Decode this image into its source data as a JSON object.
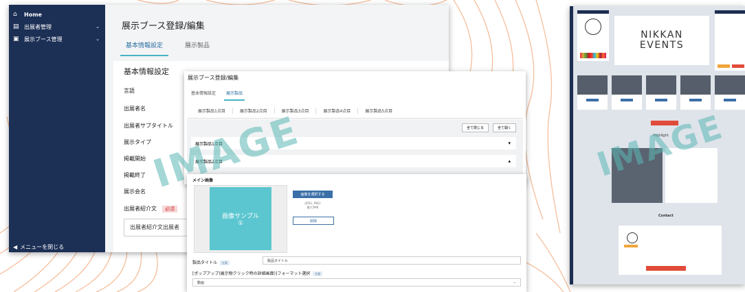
{
  "sidebar": {
    "items": [
      {
        "label": "Home",
        "icon": "home-icon"
      },
      {
        "label": "出展者管理",
        "icon": "building-icon"
      },
      {
        "label": "展示ブース管理",
        "icon": "image-icon"
      }
    ],
    "close_menu": "メニューを閉じる"
  },
  "editor": {
    "title": "展示ブース登録/編集",
    "tabs": [
      "基本情報設定",
      "展示製品"
    ],
    "section_title": "基本情報設定",
    "fields": [
      "言語",
      "出展者名",
      "出展者サブタイトル",
      "展示タイプ",
      "掲載開始",
      "掲載終了",
      "展示会名",
      "出展者紹介文"
    ],
    "required_badge": "必須",
    "intro_placeholder": "出展者紹介文出展者"
  },
  "products": {
    "title": "展示ブース登録/編集",
    "tabs": [
      "基本情報設定",
      "展示製品"
    ],
    "subtabs": [
      "展示製品1点目",
      "展示製品2点目",
      "展示製品3点目",
      "展示製品4点目",
      "展示製品5点目"
    ],
    "collapse_all": "全て閉じる",
    "expand_all": "全て開く",
    "accordions": [
      "展示製品1点目",
      "展示製品2点目"
    ]
  },
  "product_form": {
    "main_image_label": "メイン画像",
    "image_sample": "画像サンプル",
    "image_sample_num": "①",
    "select_image": "画像を選択する",
    "image_note": "(JPEG, PNG)",
    "image_note2": "最大5MB",
    "delete": "削除",
    "product_title_label": "製品タイトル",
    "optional_badge": "任意",
    "product_title_value": "製品タイトル",
    "popup_label": "[ポップアップ(展示物クリック時の詳細画面)]フォーマット選択",
    "popup_value": "動画"
  },
  "preview": {
    "logo_line1": "NIKKAN",
    "logo_line2": "EVENTS",
    "contact_title": "Contact",
    "highlight_title": "Highlight"
  },
  "watermark": "IMAGE"
}
